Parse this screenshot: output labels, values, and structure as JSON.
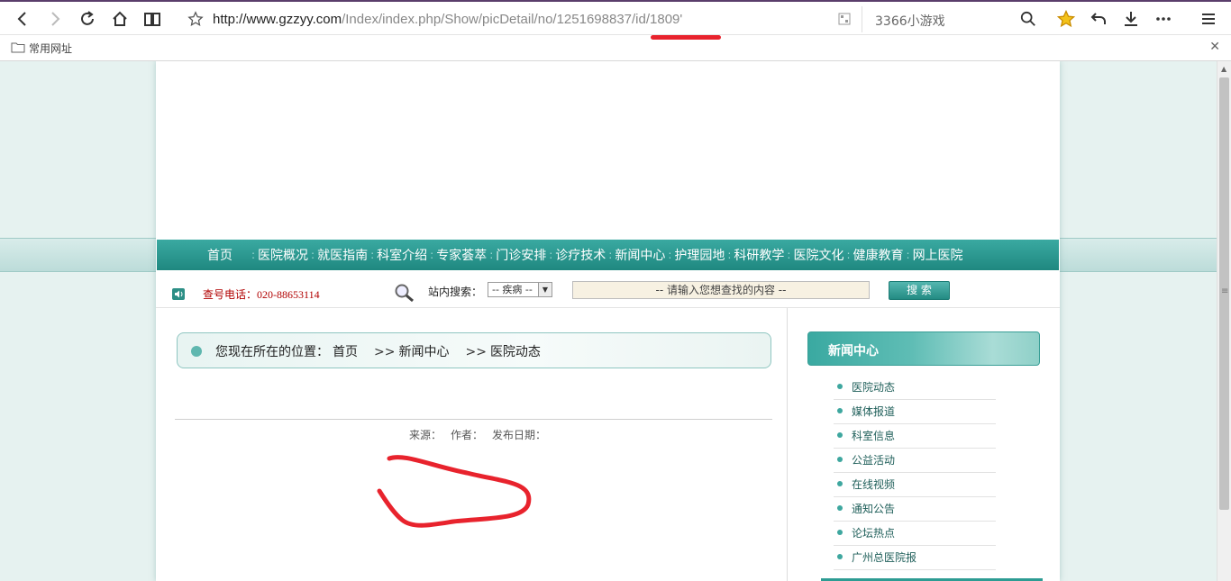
{
  "browser": {
    "url_main": "http://www.gzzyy.com",
    "url_path": "/Index/index.php/Show/picDetail/no/1251698837/id/1809'",
    "search_placeholder": "3366小游戏",
    "bookmark_folder": "常用网址"
  },
  "nav": {
    "items": [
      "首页",
      "医院概况",
      "就医指南",
      "科室介绍",
      "专家荟萃",
      "门诊安排",
      "诊疗技术",
      "新闻中心",
      "护理园地",
      "科研教学",
      "医院文化",
      "健康教育",
      "网上医院"
    ]
  },
  "infobar": {
    "phone_label": "查号电话：",
    "phone_number": "020-88653114",
    "search_label": "站内搜索：",
    "select_value": "-- 疾病 --",
    "keyword_placeholder": "-- 请输入您想查找的内容 --",
    "search_button": "搜 索"
  },
  "breadcrumb": {
    "prefix": "您现在所在的位置：",
    "items": [
      "首页",
      "新闻中心",
      "医院动态"
    ],
    "separator": ">>"
  },
  "article": {
    "source_label": "来源：",
    "author_label": "作者：",
    "date_label": "发布日期："
  },
  "sidebar": {
    "title": "新闻中心",
    "items": [
      "医院动态",
      "媒体报道",
      "科室信息",
      "公益活动",
      "在线视频",
      "通知公告",
      "论坛热点",
      "广州总医院报"
    ]
  },
  "colors": {
    "accent": "#2d8f86",
    "annotation": "#e8232d",
    "phone_text": "#b10000"
  }
}
